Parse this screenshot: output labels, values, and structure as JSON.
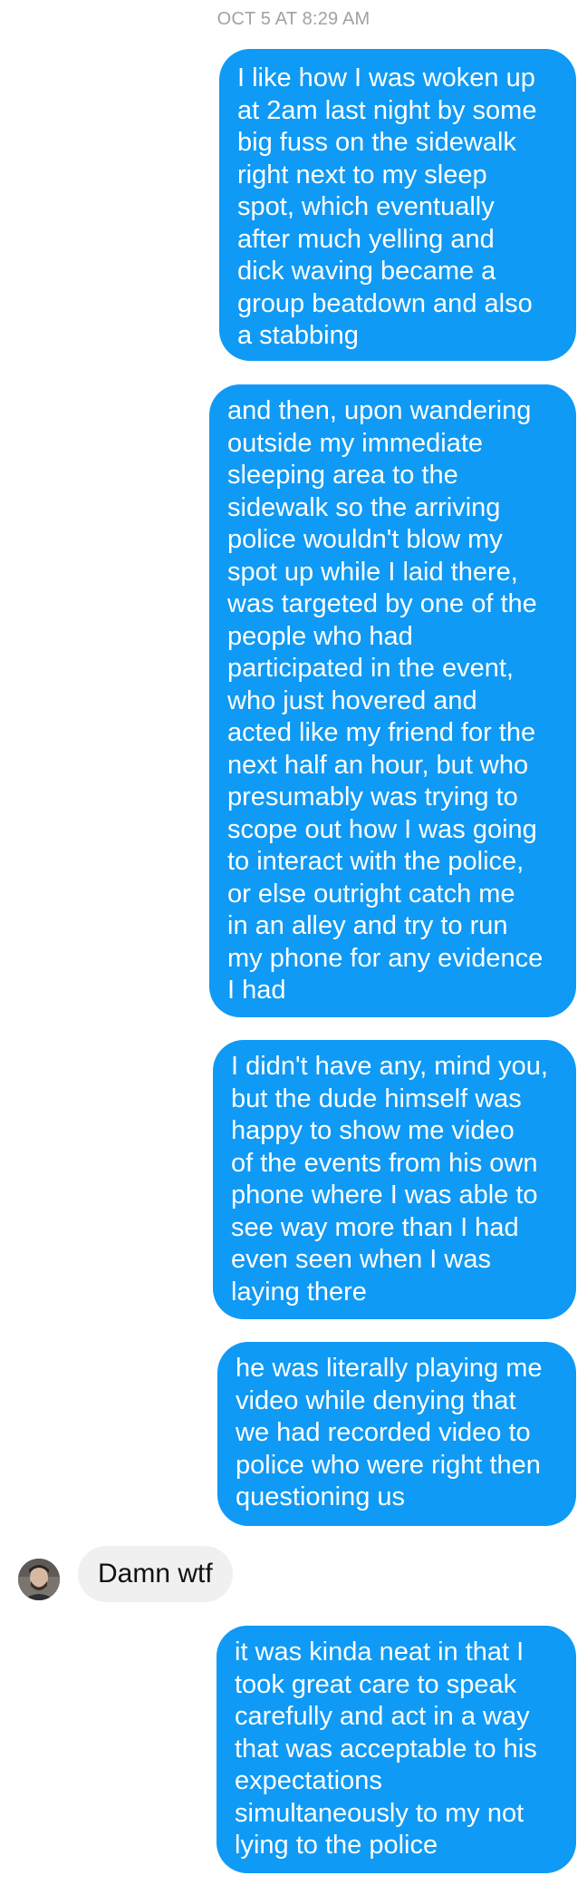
{
  "timestamp": "OCT 5 AT 8:29 AM",
  "messages": [
    {
      "direction": "outgoing",
      "text": "I like how I was woken up\nat 2am last night by some\nbig fuss on the sidewalk\nright next to my sleep\nspot, which eventually\nafter much yelling and\ndick waving became a\ngroup beatdown and also\na stabbing"
    },
    {
      "direction": "outgoing",
      "text": "and then, upon wandering\noutside my immediate\nsleeping area to the\nsidewalk so the arriving\npolice wouldn't blow my\nspot up while I laid there,\nwas targeted by one of the\npeople who had\nparticipated in the event,\nwho just hovered and\nacted like my friend for the\nnext half an hour, but who\npresumably was trying to\nscope out how I was going\nto interact with the police,\nor else outright catch me\nin an alley and try to run\nmy phone for any evidence\nI had"
    },
    {
      "direction": "outgoing",
      "text": "I didn't have any, mind you,\nbut the dude himself was\nhappy to show me video\nof the events from his own\nphone where I was able to\nsee way more than I had\neven seen when I was\nlaying there"
    },
    {
      "direction": "outgoing",
      "text": "he was literally playing me\nvideo while denying that\nwe had recorded video to\npolice who were right then\nquestioning us"
    },
    {
      "direction": "incoming",
      "text": "Damn wtf"
    },
    {
      "direction": "outgoing",
      "text": "it was kinda neat in that I\ntook great care to speak\ncarefully and act in a way\nthat was acceptable to his\nexpectations\nsimultaneously to my not\nlying to the police"
    }
  ],
  "colors": {
    "outgoing_bubble": "#0f9af5",
    "incoming_bubble": "#f1f0f0",
    "timestamp": "#a2a2a6"
  },
  "icons": {
    "avatar": "contact-avatar-photo"
  }
}
